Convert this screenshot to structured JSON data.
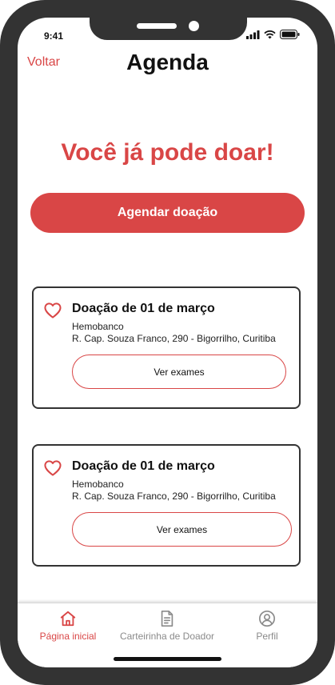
{
  "status_bar": {
    "time": "9:41"
  },
  "header": {
    "back_label": "Voltar",
    "title": "Agenda"
  },
  "main": {
    "headline": "Você já pode doar!",
    "schedule_button": "Agendar doação",
    "donations": [
      {
        "title": "Doação de 01 de março",
        "place": "Hemobanco",
        "address": "R. Cap. Souza Franco, 290 - Bigorrilho, Curitiba",
        "button": "Ver exames"
      },
      {
        "title": "Doação de 01 de março",
        "place": "Hemobanco",
        "address": "R. Cap. Souza Franco, 290 - Bigorrilho, Curitiba",
        "button": "Ver exames"
      }
    ]
  },
  "tabbar": {
    "items": [
      {
        "label": "Página inicial",
        "icon": "home-icon",
        "active": true
      },
      {
        "label": "Carteirinha de Doador",
        "icon": "document-icon",
        "active": false
      },
      {
        "label": "Perfil",
        "icon": "user-circle-icon",
        "active": false
      }
    ]
  },
  "colors": {
    "accent": "#d94646",
    "inactive": "#8a8a8a",
    "frame": "#333333"
  }
}
